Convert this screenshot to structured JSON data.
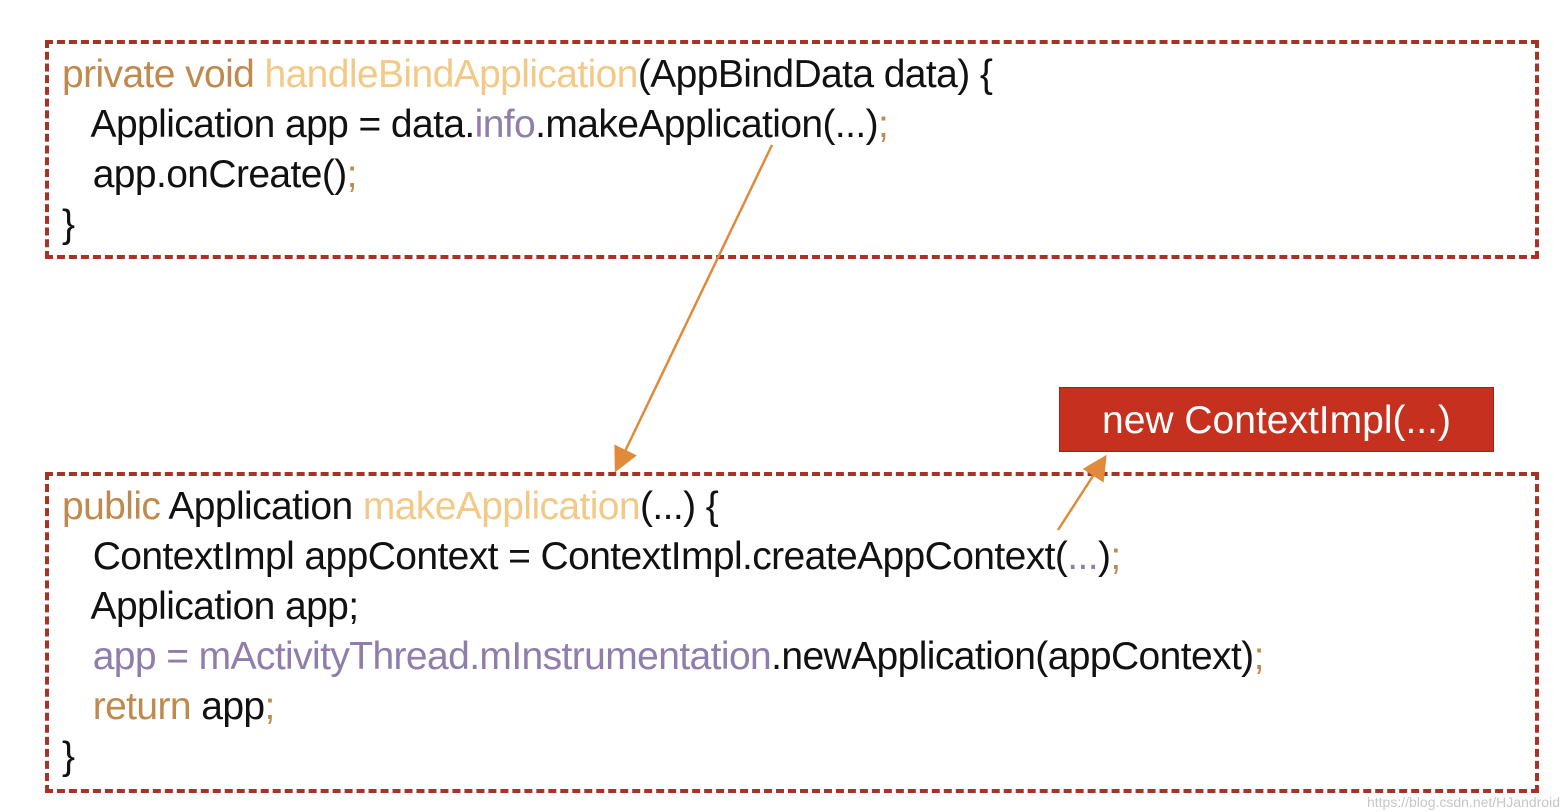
{
  "colors": {
    "border": "#a93226",
    "keyword": "#c08a4e",
    "method": "#f3c987",
    "field": "#8f7dab",
    "arrow": "#e08a3c",
    "label_bg": "#c5301f"
  },
  "top_block": {
    "lines": [
      [
        {
          "t": "private void ",
          "c": "kw"
        },
        {
          "t": "handleBindApplication",
          "c": "fn"
        },
        {
          "t": "(AppBindData data) {",
          "c": "pl"
        }
      ],
      [
        {
          "t": "   Application app = data.",
          "c": "pl"
        },
        {
          "t": "info",
          "c": "fld"
        },
        {
          "t": ".makeApplication(...)",
          "c": "pl"
        },
        {
          "t": ";",
          "c": "kw"
        }
      ],
      [
        {
          "t": "   app.onCreate()",
          "c": "pl"
        },
        {
          "t": ";",
          "c": "kw"
        }
      ],
      [
        {
          "t": "}",
          "c": "pl"
        }
      ]
    ]
  },
  "bottom_block": {
    "lines": [
      [
        {
          "t": "public ",
          "c": "kw"
        },
        {
          "t": "Application ",
          "c": "pl"
        },
        {
          "t": "makeApplication",
          "c": "fn"
        },
        {
          "t": "(...) {",
          "c": "pl"
        }
      ],
      [
        {
          "t": "   ContextImpl appContext = ContextImpl.createAppContext(",
          "c": "pl"
        },
        {
          "t": "...",
          "c": "fld"
        },
        {
          "t": ")",
          "c": "pl"
        },
        {
          "t": ";",
          "c": "kw"
        }
      ],
      [
        {
          "t": "   Application app;",
          "c": "pl"
        }
      ],
      [
        {
          "t": "   app = mActivityThread.mInstrumentation",
          "c": "fld"
        },
        {
          "t": ".newApplication(appContext)",
          "c": "pl"
        },
        {
          "t": ";",
          "c": "kw"
        }
      ],
      [
        {
          "t": "   return ",
          "c": "kw"
        },
        {
          "t": "app",
          "c": "pl"
        },
        {
          "t": ";",
          "c": "kw"
        }
      ],
      [
        {
          "t": "}",
          "c": "pl"
        }
      ]
    ]
  },
  "callout": {
    "label": "new ContextImpl(...)"
  },
  "watermark": "https://blog.csdn.net/HJandroid"
}
